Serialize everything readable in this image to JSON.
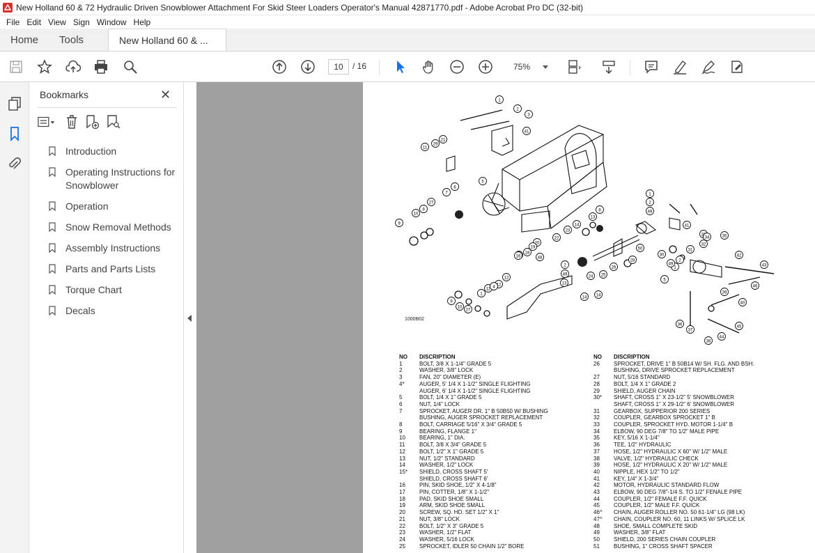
{
  "window": {
    "title": "New Holland 60 & 72 Hydraulic Driven Snowblower Attachment For Skid Steer Loaders Operator's Manual 42871770.pdf - Adobe Acrobat Pro DC (32-bit)"
  },
  "menu": [
    "File",
    "Edit",
    "View",
    "Sign",
    "Window",
    "Help"
  ],
  "tabs": {
    "home": "Home",
    "tools": "Tools",
    "document": "New Holland 60 & ..."
  },
  "toolbar": {
    "page_current": "10",
    "page_total": "/ 16",
    "zoom": "75%"
  },
  "bookmarks": {
    "title": "Bookmarks",
    "items": [
      "Introduction",
      "Operating Instructions for Snowblower",
      "Operation",
      "Snow Removal Methods",
      "Assembly Instructions",
      "Parts and Parts Lists",
      "Torque Chart",
      "Decals"
    ]
  },
  "document": {
    "figure_label": "1000B02",
    "header_no": "NO",
    "header_desc": "DISCRIPTION",
    "parts_left": [
      [
        "1",
        "BOLT, 3/8 X 1-1/4\" GRADE 5"
      ],
      [
        "2",
        "WASHER, 3/8\" LOCK"
      ],
      [
        "3",
        "FAN, 20\" DIAMETER (E)"
      ],
      [
        "4*",
        "AUGER, 5' 1/4 X 1-1/2\"  SINGLE FLIGHTING"
      ],
      [
        "",
        "AUGER, 6' 1/4 X 1-1/2\"  SINGLE FLIGHTING"
      ],
      [
        "5",
        "BOLT, 1/4 X 1\" GRADE 5"
      ],
      [
        "6",
        "NUT, 1/4\" LOCK"
      ],
      [
        "7",
        "SPROCKET, AUGER DR. 1\" B 50B50 W/ BUSHING"
      ],
      [
        "",
        "BUSHING, AUGER SPROCKET REPLACEMENT"
      ],
      [
        "8",
        "BOLT, CARRIAGE 5/16\" X 3/4\" GRADE 5"
      ],
      [
        "9",
        "BEARING, FLANGE 1\""
      ],
      [
        "10",
        "BEARING, 1\"  DIA."
      ],
      [
        "11",
        "BOLT, 3/8 X 3/4\" GRADE 5"
      ],
      [
        "12",
        "BOLT, 1/2\" X 1\" GRADE 5"
      ],
      [
        "13",
        "NUT, 1/2\" STANDARD"
      ],
      [
        "14",
        "WASHER, 1/2\" LOCK"
      ],
      [
        "15*",
        "SHIELD, CROSS SHAFT 5'"
      ],
      [
        "",
        "SHIELD, CROSS SHAFT 6'"
      ],
      [
        "16",
        "PIN, SKID SHOE, 1/2\" X 4-1/8\""
      ],
      [
        "17",
        "PIN, COTTER, 1/8\" X 1-1/2\""
      ],
      [
        "18",
        "PAD, SKID SHOE SMALL"
      ],
      [
        "19",
        "ARM, SKID SHOE SMALL"
      ],
      [
        "20",
        "SCREW, SQ. HD. SET  1/2\" X 1\""
      ],
      [
        "21",
        "NUT, 3/8\" LOCK"
      ],
      [
        "22",
        "BOLT, 1/2\" X 3\" GRADE 5"
      ],
      [
        "23",
        "WASHER, 1/2\" FLAT"
      ],
      [
        "24",
        "WASHER, 5/16 LOCK"
      ],
      [
        "25",
        "SPROCKET, IDLER  50 CHAIN  1/2\" BORE"
      ]
    ],
    "parts_right": [
      [
        "26",
        "SPROCKET, DRIVE  1\" B 50B14 W/ SH. FLG. AND BSH."
      ],
      [
        "",
        "BUSHING, DRIVE SPROCKET  REPLACEMENT"
      ],
      [
        "27",
        "NUT, 5/16 STANDARD"
      ],
      [
        "28",
        "BOLT, 1/4 X 1\" GRADE 2"
      ],
      [
        "29",
        "SHIELD, AUGER CHAIN"
      ],
      [
        "30*",
        "SHAFT, CROSS 1\" X 23-1/2\"  5' SNOWBLOWER"
      ],
      [
        "",
        "SHAFT, CROSS 1\" X 29-1/2\"  6' SNOWBLOWER"
      ],
      [
        "31",
        "GEARBOX, SUPPERIOR 200 SERIES"
      ],
      [
        "32",
        "COUPLER, GEARBOX  SPROCKET 1\" B"
      ],
      [
        "33",
        "COUPLER,  SPROCKET HYD. MOTOR 1-1/4\" B"
      ],
      [
        "34",
        "ELBOW, 90 DEG  7/8\" TO 1/2\" MALE PIPE"
      ],
      [
        "35",
        "KEY, 5/16 X 1-1/4\""
      ],
      [
        "36",
        "TEE, 1/2\" HYDRAULIC"
      ],
      [
        "37",
        "HOSE, 1/2\" HYDRAULIC X 60\" W/ 1/2\" MALE"
      ],
      [
        "38",
        "VALVE, 1/2\" HYDRAULIC CHECK"
      ],
      [
        "39",
        "HOSE, 1/2\" HYDRAULIC X 20\" W/ 1/2\" MALE"
      ],
      [
        "40",
        "NIPPLE, HEX  1/2\" TO 1/2\""
      ],
      [
        "41",
        "KEY, 1/4\" X 1-3/4\""
      ],
      [
        "42",
        "MOTOR, HYDRAULIC STANDARD FLOW"
      ],
      [
        "43",
        "ELBOW, 90 DEG 7/8\"-1/4 S. TO 1/2\" FENALE PIPE"
      ],
      [
        "44",
        "COUPLER, 1/2\" FEMALE F.F. QUICK"
      ],
      [
        "45",
        "COUPLER, 1/2\" MALE F.F. QUICK"
      ],
      [
        "46^",
        "CHAIN, AUGER ROLLER  NO. 50 61-1/4\" LG (98 LK)"
      ],
      [
        "47^",
        "CHAIN, COUPLER  NO. 60, 11 LINKS W/ SPLICE LK"
      ],
      [
        "48",
        "SHOE, SMALL COMPLETE SKID"
      ],
      [
        "49",
        "WASHER, 3/8\" FLAT"
      ],
      [
        "50",
        "SHIELD, 200 SERIES CHAIN COUPLER"
      ],
      [
        "51",
        "BUSHING,  1\" CROSS SHAFT SPACER"
      ]
    ],
    "callouts": [
      "1",
      "2",
      "3",
      "41",
      "21",
      "29",
      "11",
      "5",
      "6",
      "7",
      "27",
      "9",
      "10",
      "9",
      "8",
      "13",
      "14",
      "23",
      "22",
      "20",
      "19",
      "18",
      "17",
      "48",
      "16",
      "1",
      "2",
      "49",
      "41",
      "50",
      "33",
      "34",
      "32",
      "31",
      "30",
      "28",
      "26",
      "25",
      "24",
      "12",
      "11",
      "1",
      "2",
      "49",
      "13",
      "14",
      "14",
      "12",
      "4",
      "9",
      "10",
      "27",
      "5",
      "1",
      "2",
      "49",
      "35",
      "42",
      "43",
      "46",
      "39",
      "40",
      "36",
      "37",
      "44",
      "38",
      "45"
    ]
  },
  "colors": {
    "accent": "#1473e6",
    "viewer_bg": "#9f9f9f",
    "tab_bg": "#f0f0f0"
  }
}
